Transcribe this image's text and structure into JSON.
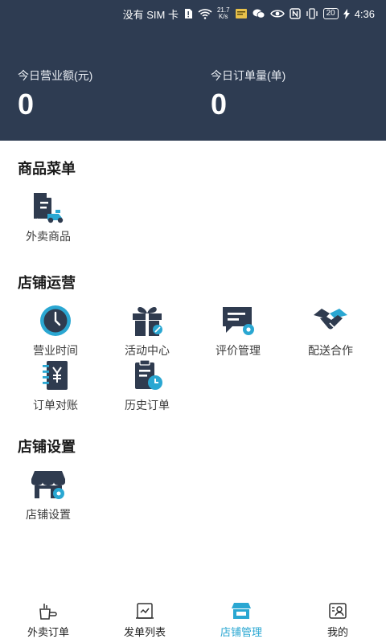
{
  "status_bar": {
    "carrier": "没有 SIM 卡",
    "net_speed_value": "21.7",
    "net_speed_unit": "K/s",
    "battery": "20",
    "time": "4:36"
  },
  "header": {
    "sales_label": "今日营业额(元)",
    "sales_value": "0",
    "orders_label": "今日订单量(单)",
    "orders_value": "0"
  },
  "sections": {
    "menu": {
      "title": "商品菜单",
      "items": [
        {
          "label": "外卖商品",
          "icon": "takeout-goods-icon"
        }
      ]
    },
    "operations": {
      "title": "店铺运营",
      "items": [
        {
          "label": "营业时间",
          "icon": "clock-icon"
        },
        {
          "label": "活动中心",
          "icon": "gift-icon"
        },
        {
          "label": "评价管理",
          "icon": "review-icon"
        },
        {
          "label": "配送合作",
          "icon": "handshake-icon"
        },
        {
          "label": "订单对账",
          "icon": "reconcile-icon"
        },
        {
          "label": "历史订单",
          "icon": "history-order-icon"
        }
      ]
    },
    "settings": {
      "title": "店铺设置",
      "items": [
        {
          "label": "店铺设置",
          "icon": "store-settings-icon"
        }
      ]
    }
  },
  "tabs": [
    {
      "label": "外卖订单",
      "icon": "takeout-order-icon",
      "active": false
    },
    {
      "label": "发单列表",
      "icon": "dispatch-list-icon",
      "active": false
    },
    {
      "label": "店铺管理",
      "icon": "store-manage-icon",
      "active": true
    },
    {
      "label": "我的",
      "icon": "profile-icon",
      "active": false
    }
  ],
  "colors": {
    "header_bg": "#2e3c52",
    "icon_dark": "#2f3b4f",
    "accent": "#2aa7d2"
  }
}
